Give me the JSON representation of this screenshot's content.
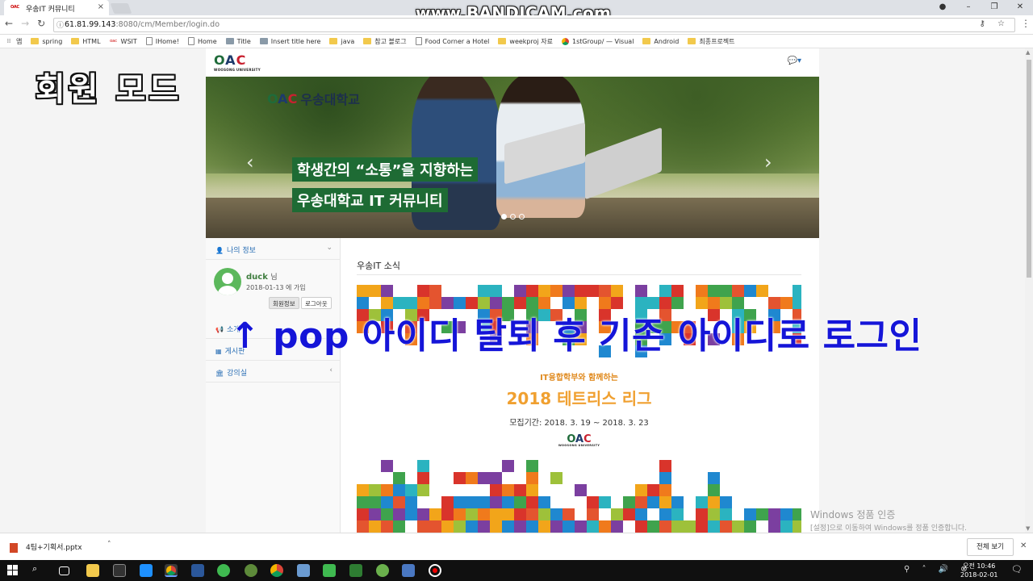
{
  "browser": {
    "tab_title": "우송IT 커뮤니티",
    "tab_favicon": "OAC",
    "tab_close": "×",
    "watermark": "www.BANDICAM.com",
    "url_host": "61.81.99.143",
    "url_path": ":8080/cm/Member/login.do",
    "omni_icons": "⚷ ☆",
    "bookmarks": [
      {
        "label": "앱",
        "icon": "apps-icon"
      },
      {
        "label": "spring",
        "icon": "folder-icon"
      },
      {
        "label": "HTML",
        "icon": "folder-icon"
      },
      {
        "label": "WSIT",
        "icon": "site-icon"
      },
      {
        "label": "IHome!",
        "icon": "page-icon"
      },
      {
        "label": "Home",
        "icon": "page-icon"
      },
      {
        "label": "Title",
        "icon": "image-icon"
      },
      {
        "label": "Insert title here",
        "icon": "image-icon"
      },
      {
        "label": "java",
        "icon": "folder-icon"
      },
      {
        "label": "참고 블로그",
        "icon": "folder-icon"
      },
      {
        "label": "Food Corner a Hotel",
        "icon": "page-icon"
      },
      {
        "label": "weekproj 자료",
        "icon": "folder-icon"
      },
      {
        "label": "1stGroup/ — Visual",
        "icon": "chrome-icon"
      },
      {
        "label": "Android",
        "icon": "folder-icon"
      },
      {
        "label": "최종프로젝트",
        "icon": "folder-icon"
      }
    ]
  },
  "overlay": {
    "mode_label": "회원 모드",
    "caption": "↑ pop 아이디 탈퇴 후 기존 아이디로 로그인"
  },
  "site": {
    "logo_text": "OAC",
    "logo_sub": "WOOSONG UNIVERSITY",
    "carousel": {
      "banner_logo": "OAC",
      "banner_name": "우송대학교",
      "caption_line1": "학생간의 “소통”을 지향하는",
      "caption_line2": "우송대학교 IT 커뮤니티",
      "prev": "‹",
      "next": "›"
    },
    "sidebar": {
      "my_info": "나의 정보",
      "username": "duck",
      "username_suffix": "님",
      "joined": "2018-01-13 에 가입",
      "btn_member_info": "회원정보",
      "btn_logout": "로그아웃",
      "intro": "소개",
      "board": "게시판",
      "lecture_room": "강의실"
    },
    "main": {
      "news_title": "우송IT 소식",
      "poster_sub": "IT융합학부와 함께하는",
      "poster_title": "2018 테트리스 리그",
      "poster_date": "모집기간: 2018. 3. 19 ~ 2018. 3. 23",
      "poster_logo": "OAC",
      "poster_logo_sub": "WOOSONG UNIVERSITY"
    }
  },
  "windows": {
    "activation_title": "Windows 정품 인증",
    "activation_sub": "[설정]으로 이동하여 Windows를 정품 인증합니다.",
    "download_file": "4팀+기획서.pptx",
    "show_all": "전체 보기",
    "clock_time": "오전 10:46",
    "clock_date": "2018-02-01"
  },
  "colors": {
    "green": "#1e6b34",
    "red": "#c8202f",
    "blue_overlay": "#1515d8"
  }
}
